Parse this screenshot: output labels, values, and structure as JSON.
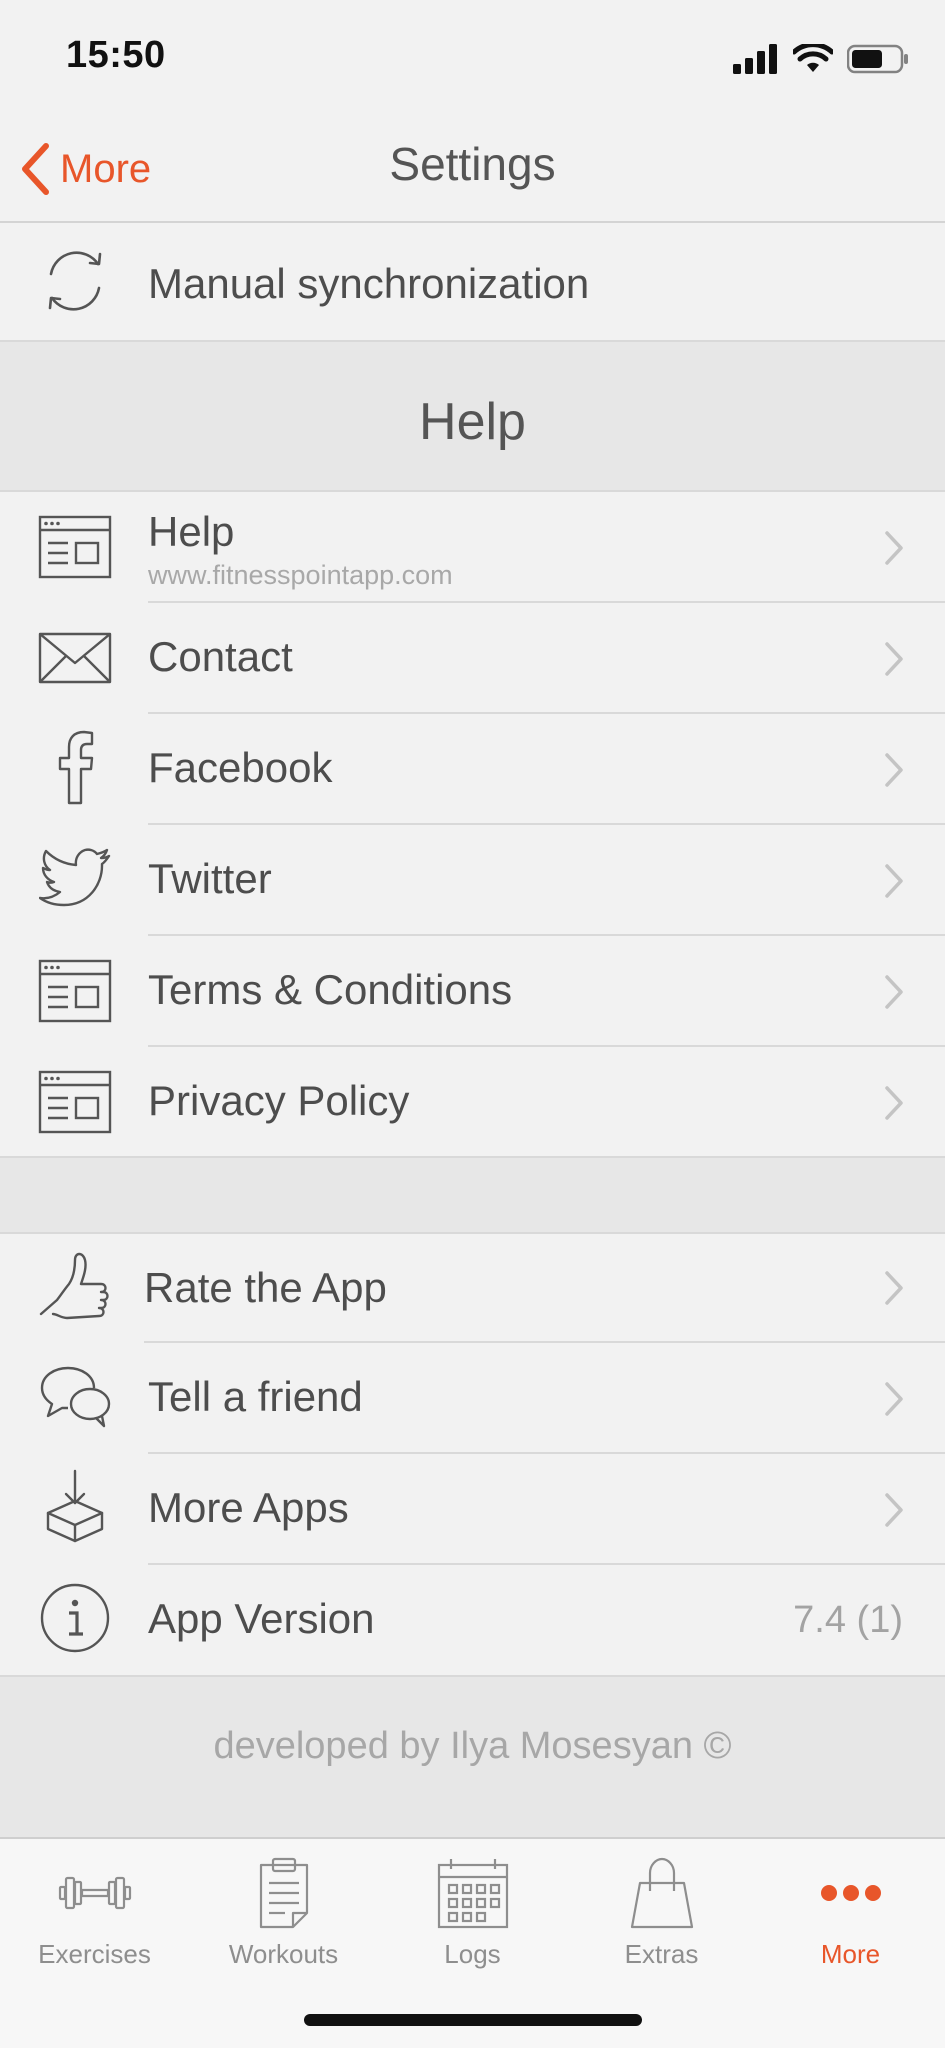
{
  "status": {
    "time": "15:50"
  },
  "nav": {
    "back_label": "More",
    "title": "Settings"
  },
  "sync": {
    "label": "Manual synchronization"
  },
  "help_section": {
    "title": "Help",
    "items": [
      {
        "label": "Help",
        "sub": "www.fitnesspointapp.com",
        "icon": "browser-window-icon"
      },
      {
        "label": "Contact",
        "icon": "envelope-icon"
      },
      {
        "label": "Facebook",
        "icon": "facebook-icon"
      },
      {
        "label": "Twitter",
        "icon": "twitter-bird-icon"
      },
      {
        "label": "Terms & Conditions",
        "icon": "browser-window-icon"
      },
      {
        "label": "Privacy Policy",
        "icon": "browser-window-icon"
      }
    ]
  },
  "app_section": {
    "items": [
      {
        "label": "Rate the App",
        "icon": "thumbs-up-icon"
      },
      {
        "label": "Tell a friend",
        "icon": "speech-bubbles-icon"
      },
      {
        "label": "More Apps",
        "icon": "download-box-icon"
      },
      {
        "label": "App Version",
        "value": "7.4 (1)",
        "icon": "info-icon"
      }
    ]
  },
  "footer": {
    "credit": "developed by Ilya Mosesyan ©"
  },
  "tabs": [
    {
      "label": "Exercises",
      "icon": "dumbbell-icon"
    },
    {
      "label": "Workouts",
      "icon": "clipboard-icon"
    },
    {
      "label": "Logs",
      "icon": "calendar-icon"
    },
    {
      "label": "Extras",
      "icon": "shopping-bag-icon"
    },
    {
      "label": "More",
      "icon": "more-dots-icon",
      "active": true
    }
  ],
  "colors": {
    "accent": "#e8562a",
    "text": "#4d4d4d",
    "muted": "#a8a8a8",
    "background": "#f2f2f2",
    "section": "#e7e7e7"
  }
}
